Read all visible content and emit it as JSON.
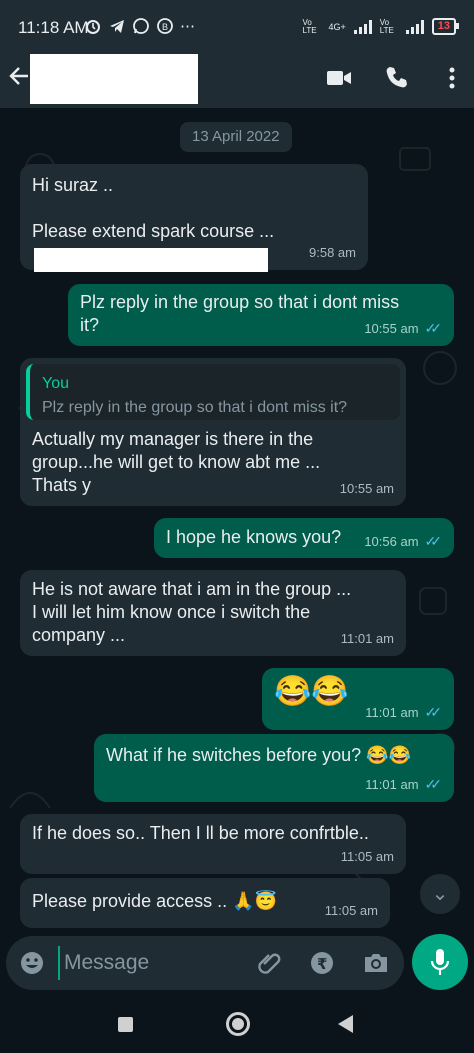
{
  "status_bar": {
    "time": "11:18 AM",
    "notification_icons": [
      "alarm-icon",
      "telegram-icon",
      "whatsapp-icon",
      "whatsapp-business-icon"
    ],
    "overflow": "⋯",
    "network_label_1": "Vo LTE",
    "network_type": "4G+",
    "network_label_2": "Vo LTE",
    "battery": "13"
  },
  "header": {
    "contact_name_redacted": true,
    "icons": [
      "back-arrow-icon",
      "video-call-icon",
      "voice-call-icon",
      "more-options-icon"
    ]
  },
  "chat": {
    "date_chip": "13 April 2022",
    "messages": [
      {
        "dir": "in",
        "text": "Hi suraz ..\n\nPlease extend spark course ...",
        "time": "9:58 am"
      },
      {
        "dir": "out",
        "text": "Plz reply in the group so that i dont miss\nit?",
        "time": "10:55 am"
      },
      {
        "dir": "in",
        "quote_name": "You",
        "quote_text": "Plz reply in the group so that i dont miss it?",
        "text": "Actually my manager is there in the\ngroup...he will get to know abt me ...\nThats y",
        "time": "10:55 am"
      },
      {
        "dir": "out",
        "text": "I hope he knows you?",
        "time": "10:56 am"
      },
      {
        "dir": "in",
        "text": "He is not aware that i am in the group ...\nI will let him know once i switch the\ncompany ...",
        "time": "11:01 am"
      },
      {
        "dir": "out",
        "text": "😂😂",
        "time": "11:01 am"
      },
      {
        "dir": "out",
        "text": "What if he switches before you? 😂😂",
        "time": "11:01 am"
      },
      {
        "dir": "in",
        "text": "If he does so.. Then I ll be more confrtble..",
        "time": "11:05 am"
      },
      {
        "dir": "in",
        "text": "Please provide access .. 🙏😇",
        "time": "11:05 am"
      }
    ],
    "read_ticks": "✓✓",
    "scroll_down_glyph": "⌄"
  },
  "composer": {
    "placeholder": "Message"
  },
  "colors": {
    "background": "#0b141a",
    "incoming_bubble": "#202c33",
    "outgoing_bubble": "#005c4b",
    "accent": "#00a884",
    "read_tick": "#53bdeb"
  }
}
